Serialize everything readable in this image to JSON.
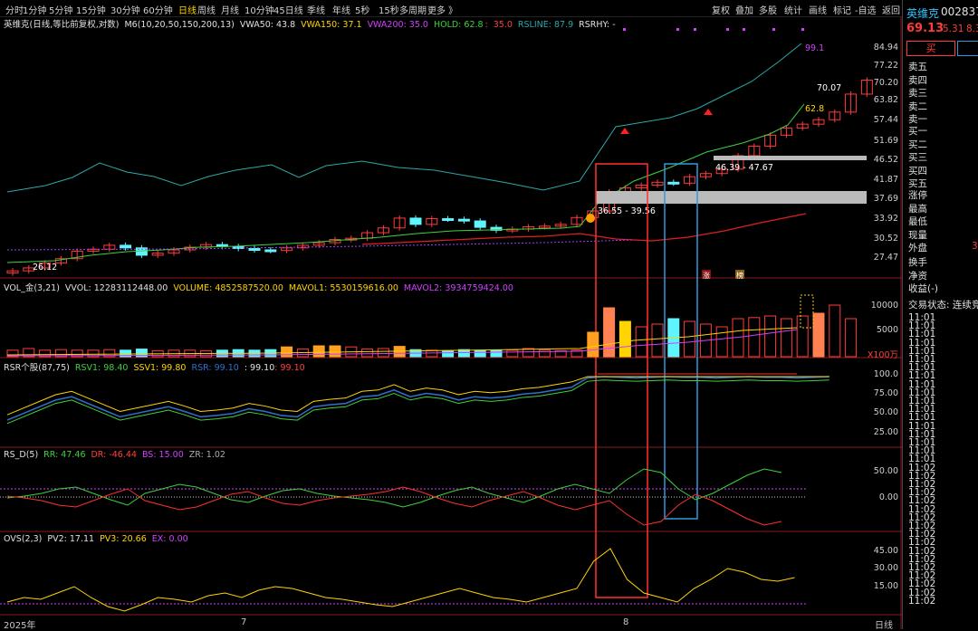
{
  "toolbar": {
    "periods": [
      "分时",
      "1分钟",
      "5分钟",
      "15分钟",
      "30分钟",
      "60分钟",
      "日线",
      "周线",
      "月线",
      "10分钟",
      "45日线",
      "季线",
      "年线",
      "5秒",
      "15秒",
      "多周期",
      "更多 》"
    ],
    "active_period": "日线",
    "right": [
      "复权",
      "叠加",
      "多股",
      "统计",
      "画线",
      "标记",
      "-自选",
      "返回"
    ]
  },
  "main": {
    "title": "英维克(日线,等比前复权,对数)",
    "indicator": "M6(10,20,50,150,200,13)",
    "vwa50": "VWA50: 43.8",
    "vwa150": "VWA150: 37.1",
    "vwa200": "VWA200: 35.0",
    "hold": "HOLD: 62.8",
    "hold_val": "35.0",
    "rsline": "RSLINE: 87.9",
    "rsrhy": "RSRHY: -",
    "price_axis": [
      "84.94",
      "77.22",
      "70.20",
      "63.82",
      "57.44",
      "51.69",
      "46.52",
      "41.87",
      "37.69",
      "33.92",
      "30.52",
      "27.47"
    ],
    "labels": {
      "top_rsline": "99.1",
      "last_price": "70.07",
      "hold_last": "62.8",
      "zone_upper": "46.39 - 47.67",
      "zone_lower": "36.55 - 39.56",
      "low_mark": "26.12",
      "tag1": "涨",
      "tag2": "榜"
    }
  },
  "vol": {
    "name": "VOL_金(3,21)",
    "vvol": "VVOL: 12283112448.00",
    "volume": "VOLUME: 4852587520.00",
    "mavol1": "MAVOL1: 5530159616.00",
    "mavol2": "MAVOL2: 3934759424.00",
    "axis": [
      "10000",
      "5000"
    ],
    "unit": "X100万"
  },
  "rsr": {
    "name": "RSR个股(87,75)",
    "rsv1": "RSV1: 98.40",
    "ssv1": "SSV1: 99.80",
    "rsr": "RSR: 99.10",
    "v4": ": 99.10",
    "v5": ": 99.10",
    "axis": [
      "100.0",
      "75.00",
      "50.00",
      "25.00"
    ]
  },
  "rsd": {
    "name": "RS_D(5)",
    "rr": "RR: 47.46",
    "dr": "DR: -46.44",
    "bs": "BS: 15.00",
    "zr": "ZR: 1.02",
    "axis": [
      "50.00",
      "0.00"
    ]
  },
  "ovs": {
    "name": "OVS(2,3)",
    "pv2": "PV2: 17.11",
    "pv3": "PV3: 20.66",
    "ex": "EX: 0.00",
    "axis": [
      "45.00",
      "30.00",
      "15.00"
    ]
  },
  "xaxis": {
    "year": "2025年",
    "m7": "7",
    "m8": "8",
    "period": "日线"
  },
  "right_panel": {
    "name": "英维克",
    "code": "002837",
    "price": "69.13",
    "change": "5.31",
    "change_pct": "8.3",
    "buy_btn": "买",
    "sell_levels": [
      "卖五",
      "卖四",
      "卖三",
      "卖二",
      "卖一"
    ],
    "buy_levels": [
      "买一",
      "买二",
      "买三",
      "买四",
      "买五"
    ],
    "stats": [
      "涨停",
      "最高",
      "最低",
      "现量",
      "外盘"
    ],
    "outer_val": "3",
    "stats2": [
      "换手",
      "净资",
      "收益(-)"
    ],
    "trade_status": "交易状态: 连续竞",
    "times": [
      "11:01",
      "11:01",
      "11:01",
      "11:01",
      "11:01",
      "11:01",
      "11:01",
      "11:01",
      "11:01",
      "11:01",
      "11:01",
      "11:01",
      "11:01",
      "11:01",
      "11:01",
      "11:01",
      "11:01",
      "11:01",
      "11:02",
      "11:02",
      "11:02",
      "11:02",
      "11:02",
      "11:02",
      "11:02",
      "11:02",
      "11:02",
      "11:02",
      "11:02",
      "11:02",
      "11:02",
      "11:02",
      "11:02",
      "11:02",
      "11:02"
    ]
  },
  "colors": {
    "up": "#ff3b3b",
    "down": "#5ff5ff",
    "yellow": "#ffd400",
    "green": "#3cd33c",
    "magenta": "#d040ff",
    "teal": "#2aa8a8"
  }
}
